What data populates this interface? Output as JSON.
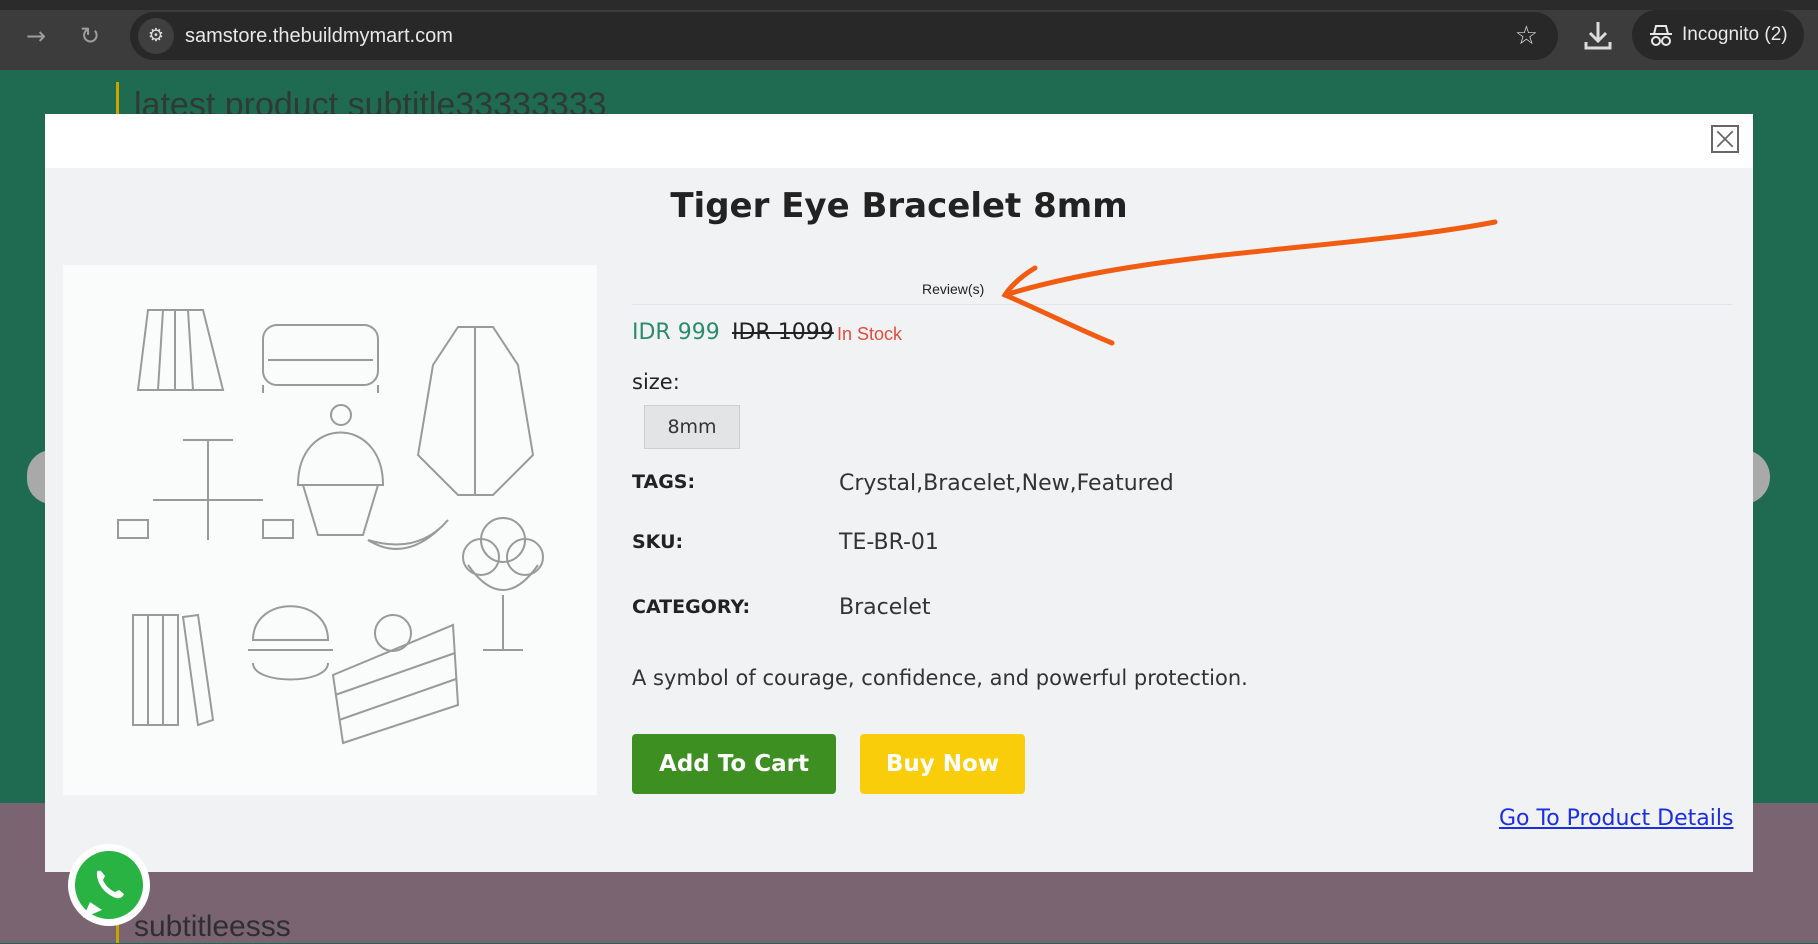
{
  "browser": {
    "url": "samstore.thebuildmymart.com",
    "incognito_label": "Incognito (2)"
  },
  "background": {
    "subtitle_top": "latest product subtitle33333333",
    "subtitle_bottom": "subtitleesss"
  },
  "modal": {
    "title": "Tiger Eye Bracelet 8mm",
    "reviews_label": "Review(s)",
    "price": "IDR 999",
    "old_price": "IDR 1099",
    "stock_status": "In Stock",
    "size_label": "size:",
    "size_option": "8mm",
    "tags_label": "TAGS:",
    "tags_value": "Crystal,Bracelet,New,Featured",
    "sku_label": "SKU:",
    "sku_value": "TE-BR-01",
    "category_label": "CATEGORY:",
    "category_value": "Bracelet",
    "description": "A symbol of courage, confidence, and powerful protection.",
    "add_to_cart": "Add To Cart",
    "buy_now": "Buy Now",
    "go_to_details": "Go To Product Details"
  },
  "colors": {
    "background_green": "#1f6b52",
    "price_green": "#2c8c6a",
    "stock_red": "#e34c3c",
    "add_to_cart_green": "#3d8f22",
    "buy_now_yellow": "#f9cd0a",
    "link_blue": "#1a2ee5",
    "annotation_orange": "#f25c12"
  },
  "icons": {
    "browser": [
      "forward-icon",
      "reload-icon",
      "site-info-icon",
      "bookmark-star-icon",
      "download-icon",
      "incognito-icon"
    ],
    "modal": [
      "close-icon",
      "whatsapp-icon"
    ]
  }
}
